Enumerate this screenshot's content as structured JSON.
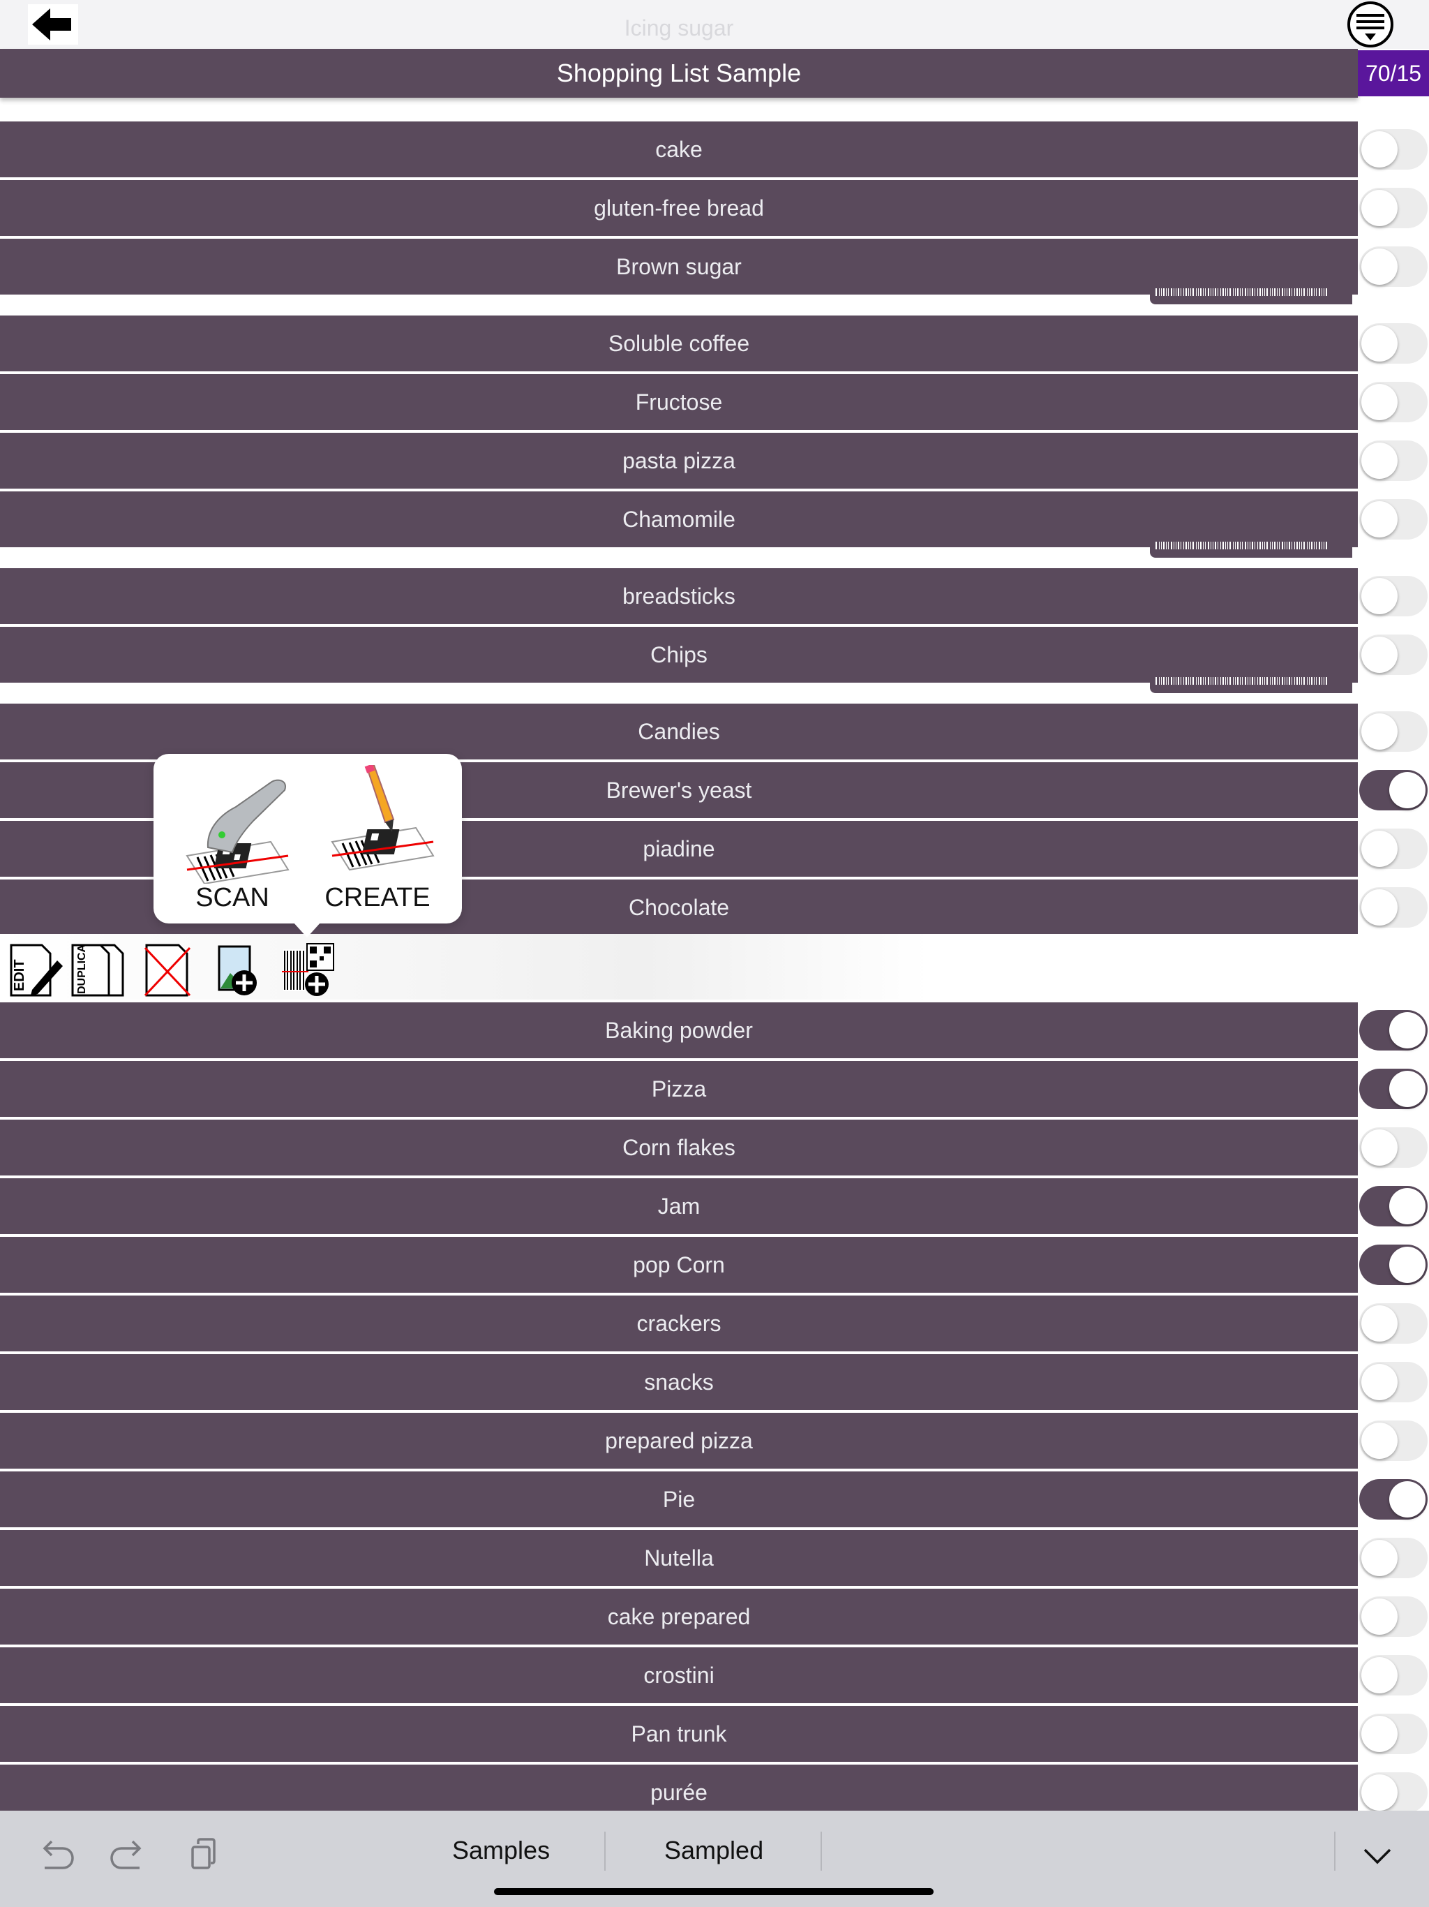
{
  "top": {
    "faded_item": "Icing sugar"
  },
  "header": {
    "title": "Shopping List Sample",
    "counter": "70/15"
  },
  "colors": {
    "row_bg": "#5a4a5c",
    "counter_bg": "#5a169c",
    "toggle_on": "#5a4a5c",
    "toggle_off": "#ececec"
  },
  "items": [
    {
      "label": "cake",
      "checked": false
    },
    {
      "label": "gluten-free bread",
      "checked": false
    },
    {
      "label": "Brown sugar",
      "checked": false
    },
    {
      "label": "Soluble coffee",
      "checked": false
    },
    {
      "label": "Fructose",
      "checked": false
    },
    {
      "label": "pasta pizza",
      "checked": false
    },
    {
      "label": "Chamomile",
      "checked": false
    },
    {
      "label": "breadsticks",
      "checked": false
    },
    {
      "label": "Chips",
      "checked": false
    },
    {
      "label": "Candies",
      "checked": false
    },
    {
      "label": "Brewer's yeast",
      "checked": true
    },
    {
      "label": "piadine",
      "checked": false
    },
    {
      "label": "Chocolate",
      "checked": false
    },
    {
      "label": "Baking powder",
      "checked": true
    },
    {
      "label": "Pizza",
      "checked": true
    },
    {
      "label": "Corn flakes",
      "checked": false
    },
    {
      "label": "Jam",
      "checked": true
    },
    {
      "label": "pop Corn",
      "checked": true
    },
    {
      "label": "crackers",
      "checked": false
    },
    {
      "label": "snacks",
      "checked": false
    },
    {
      "label": "prepared pizza",
      "checked": false
    },
    {
      "label": "Pie",
      "checked": true
    },
    {
      "label": "Nutella",
      "checked": false
    },
    {
      "label": "cake prepared",
      "checked": false
    },
    {
      "label": "crostini",
      "checked": false
    },
    {
      "label": "Pan trunk",
      "checked": false
    },
    {
      "label": "purée",
      "checked": false
    }
  ],
  "popover": {
    "scan_label": "SCAN",
    "create_label": "CREATE"
  },
  "action_bar": {
    "edit_text": "EDIT",
    "duplicate_text": "DUPLICA",
    "icons": [
      "edit-icon",
      "duplicate-icon",
      "delete-icon",
      "add-image-icon",
      "add-barcode-icon"
    ]
  },
  "bottom_bar": {
    "tabs": [
      "Samples",
      "Sampled"
    ],
    "icons": [
      "undo-icon",
      "redo-icon",
      "clipboard-icon",
      "chevron-down-icon"
    ]
  }
}
